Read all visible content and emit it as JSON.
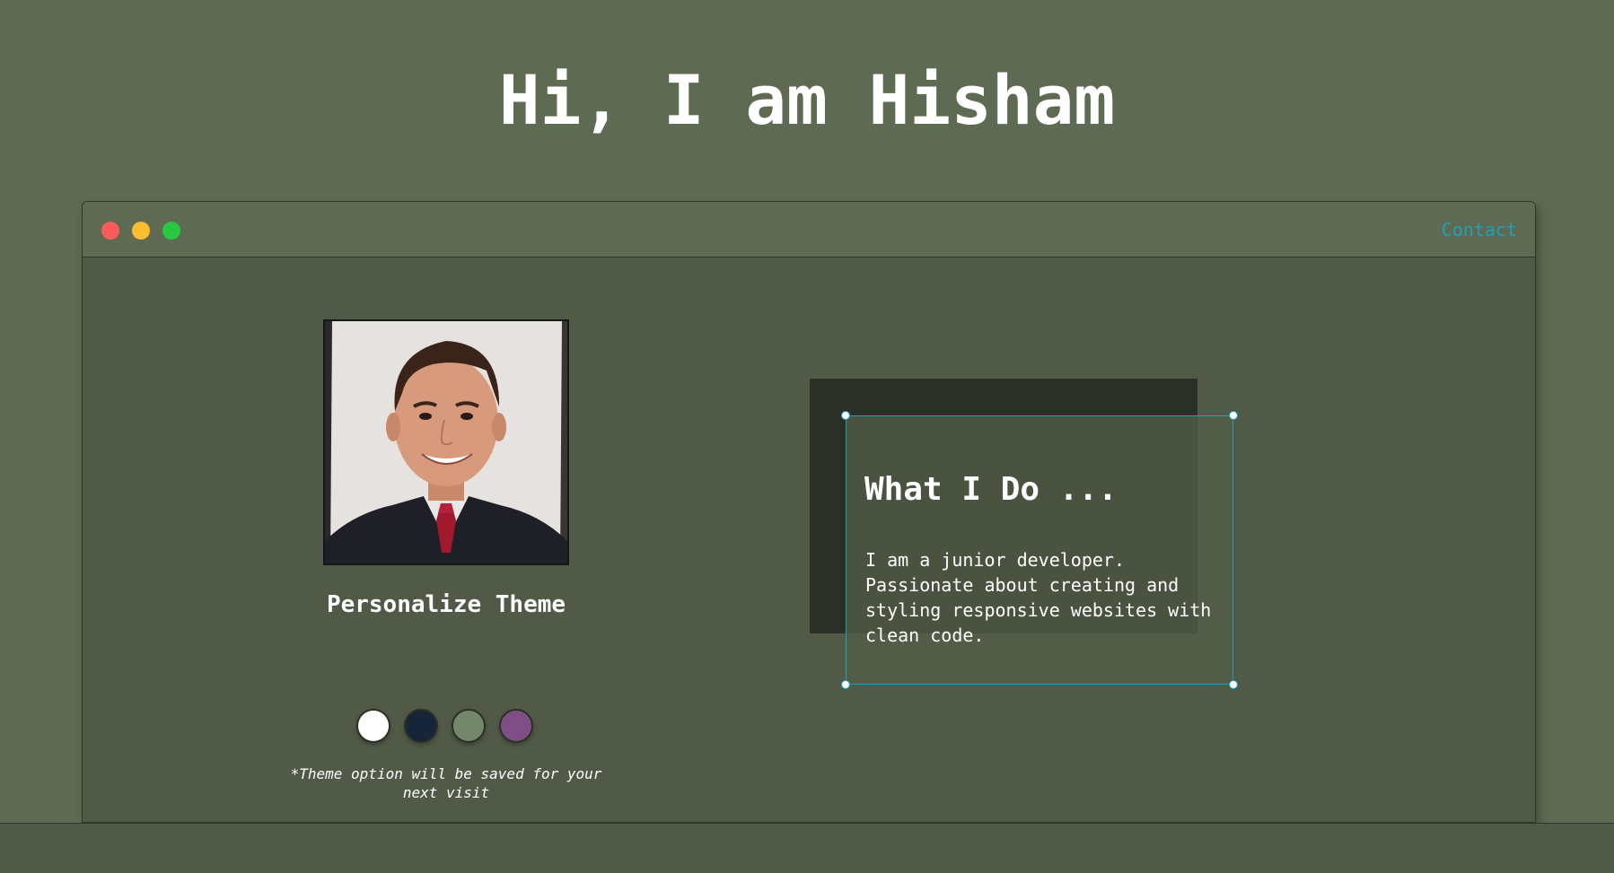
{
  "header": {
    "greeting": "Hi, I am Hisham"
  },
  "window": {
    "controls": [
      "close-dot",
      "minimize-dot",
      "maximize-dot"
    ],
    "contact_label": "Contact",
    "colors": {
      "close": "#fb5c57",
      "minimize": "#fcbc2e",
      "maximize": "#28c840",
      "accent": "#1ea1b8"
    }
  },
  "profile": {
    "photo_alt": "profile-photo"
  },
  "theme": {
    "title": "Personalize Theme",
    "note": "*Theme option will be saved for your next visit",
    "swatches": [
      {
        "name": "light",
        "color": "#ffffff"
      },
      {
        "name": "blue",
        "color": "#17253a"
      },
      {
        "name": "green",
        "color": "#75876a"
      },
      {
        "name": "purple",
        "color": "#7f4e86"
      }
    ]
  },
  "about": {
    "title": "What I Do ...",
    "text": "I am a junior developer. Passionate about creating and styling responsive websites with clean code."
  }
}
